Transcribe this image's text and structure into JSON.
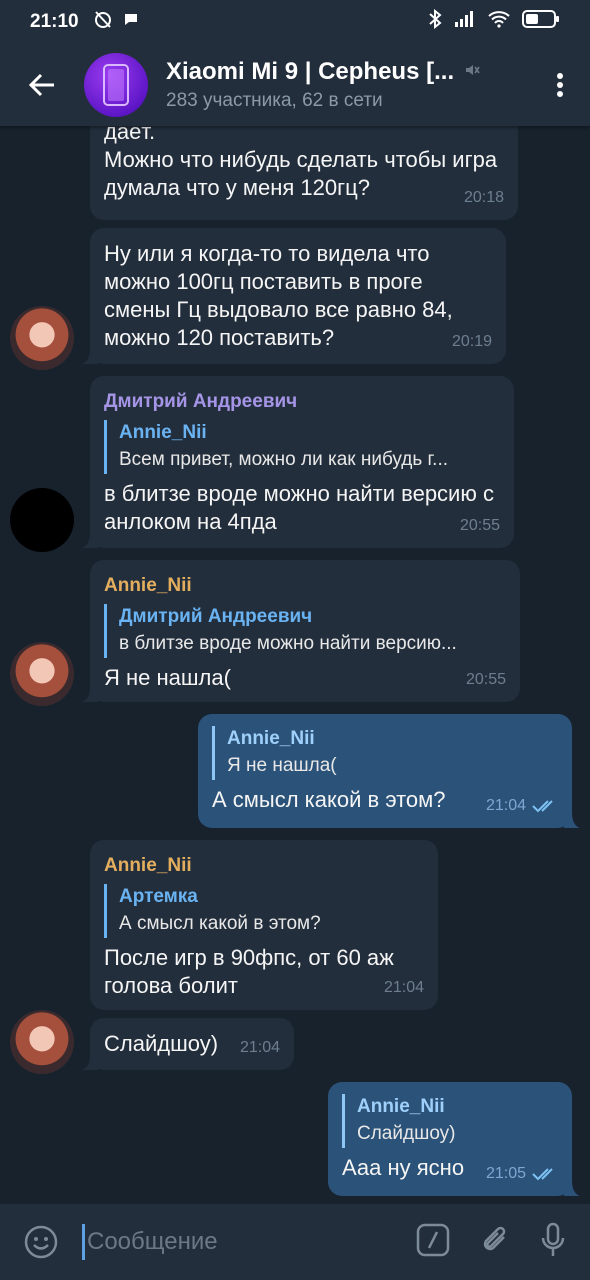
{
  "status_bar": {
    "time": "21:10"
  },
  "header": {
    "title": "Xiaomi Mi 9 | Cepheus [...",
    "subtitle": "283 участника, 62 в сети"
  },
  "messages": [
    {
      "id": "m1",
      "direction": "in",
      "text": "даёт.\nМожно что нибудь сделать чтобы игра думала что у меня 120гц?",
      "time": "20:18"
    },
    {
      "id": "m2",
      "direction": "in",
      "avatar": "annie",
      "text": "Ну или я когда-то то видела что можно 100гц поставить в проге смены Гц выдовало все равно 84, можно 120 поставить?",
      "time": "20:19"
    },
    {
      "id": "m3",
      "direction": "in",
      "avatar": "dmitry",
      "sender": "Дмитрий Андреевич",
      "sender_color": "#a695e7",
      "reply": {
        "name": "Annie_Nii",
        "text": "Всем привет, можно ли как нибудь г..."
      },
      "text": "в блитзе вроде можно найти версию с анлоком на 4пда",
      "time": "20:55"
    },
    {
      "id": "m4",
      "direction": "in",
      "avatar": "annie",
      "sender": "Annie_Nii",
      "sender_color": "#e4ae5f",
      "reply": {
        "name": "Дмитрий Андреевич",
        "text": "в блитзе вроде можно найти версию..."
      },
      "text": "Я не нашла(",
      "time": "20:55"
    },
    {
      "id": "m5",
      "direction": "out",
      "reply": {
        "name": "Annie_Nii",
        "text": "Я не нашла("
      },
      "text": "А смысл какой в этом?",
      "time": "21:04"
    },
    {
      "id": "m6",
      "direction": "in",
      "sender": "Annie_Nii",
      "sender_color": "#e4ae5f",
      "reply": {
        "name": "Артемка",
        "text": "А смысл какой в этом?"
      },
      "text": "После игр в 90фпс, от 60 аж голова болит",
      "time": "21:04"
    },
    {
      "id": "m7",
      "direction": "in",
      "avatar": "annie",
      "text": "Слайдшоу)",
      "time": "21:04"
    },
    {
      "id": "m8",
      "direction": "out",
      "reply": {
        "name": "Annie_Nii",
        "text": "Слайдшоу)"
      },
      "text": "Ааа ну ясно",
      "time": "21:05"
    }
  ],
  "input": {
    "placeholder": "Сообщение"
  },
  "colors": {
    "accent": "#6ab3f3",
    "bubble_in": "#232e3c",
    "bubble_out": "#2b5278",
    "background": "#18222d"
  }
}
